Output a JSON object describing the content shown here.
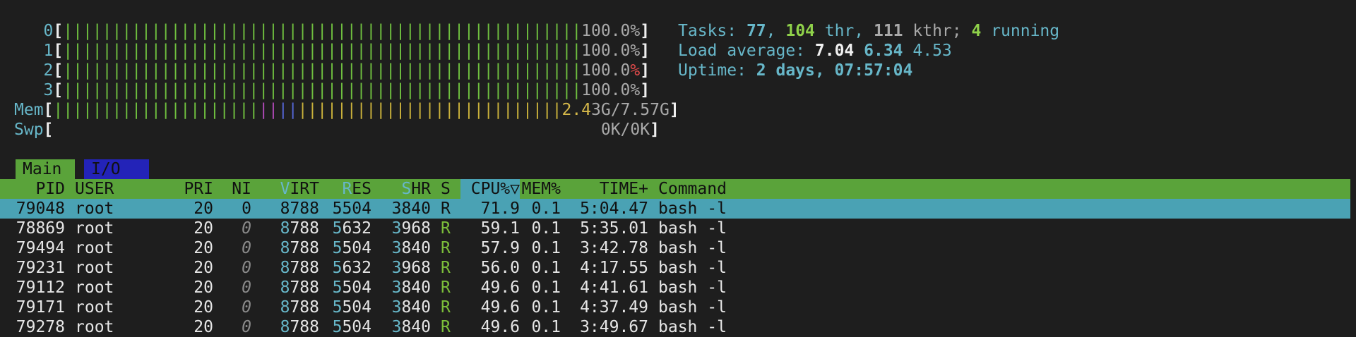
{
  "meters": {
    "cpus": [
      {
        "label": "0",
        "value": "100.0%"
      },
      {
        "label": "1",
        "value": "100.0%"
      },
      {
        "label": "2",
        "value": "100.0",
        "value_suffix": "%"
      },
      {
        "label": "3",
        "value": "100.0%"
      }
    ],
    "mem": {
      "label": "Mem",
      "value_used": "2.4",
      "value_rest": "3G/7.57G"
    },
    "swp": {
      "label": "Swp",
      "value": "0K/0K"
    }
  },
  "info": {
    "tasks_label": "Tasks: ",
    "tasks": "77",
    "thr_count": "104",
    "thr_label": " thr, ",
    "kthr_count": "111",
    "kthr_label": " kthr; ",
    "running_count": "4",
    "running_label": " running",
    "load_label": "Load average: ",
    "load1": "7.04",
    "load5": "6.34",
    "load15": "4.53",
    "uptime_label": "Uptime: ",
    "uptime": "2 days, 07:57:04"
  },
  "tabs": [
    {
      "label": "Main"
    },
    {
      "label": "I/O"
    }
  ],
  "columns": {
    "pid": "PID",
    "user": "USER",
    "pri": "PRI",
    "ni": "NI",
    "virt": "VIRT",
    "res": "RES",
    "shr": "SHR",
    "s": "S",
    "cpu": "CPU%▽",
    "mem": "MEM%",
    "time": "TIME+",
    "cmd": "Command"
  },
  "processes": [
    {
      "pid": "79048",
      "user": "root",
      "pri": "20",
      "ni": "0",
      "virt": "8788",
      "res": "5504",
      "shr": "3840",
      "s": "R",
      "cpu": "71.9",
      "mem": "0.1",
      "time": "5:04.47",
      "cmd": "bash -l"
    },
    {
      "pid": "78869",
      "user": "root",
      "pri": "20",
      "ni": "0",
      "virt": "8788",
      "res": "5632",
      "shr": "3968",
      "s": "R",
      "cpu": "59.1",
      "mem": "0.1",
      "time": "5:35.01",
      "cmd": "bash -l"
    },
    {
      "pid": "79494",
      "user": "root",
      "pri": "20",
      "ni": "0",
      "virt": "8788",
      "res": "5504",
      "shr": "3840",
      "s": "R",
      "cpu": "57.9",
      "mem": "0.1",
      "time": "3:42.78",
      "cmd": "bash -l"
    },
    {
      "pid": "79231",
      "user": "root",
      "pri": "20",
      "ni": "0",
      "virt": "8788",
      "res": "5632",
      "shr": "3968",
      "s": "R",
      "cpu": "56.0",
      "mem": "0.1",
      "time": "4:17.55",
      "cmd": "bash -l"
    },
    {
      "pid": "79112",
      "user": "root",
      "pri": "20",
      "ni": "0",
      "virt": "8788",
      "res": "5504",
      "shr": "3840",
      "s": "R",
      "cpu": "49.6",
      "mem": "0.1",
      "time": "4:41.61",
      "cmd": "bash -l"
    },
    {
      "pid": "79171",
      "user": "root",
      "pri": "20",
      "ni": "0",
      "virt": "8788",
      "res": "5504",
      "shr": "3840",
      "s": "R",
      "cpu": "49.6",
      "mem": "0.1",
      "time": "4:37.49",
      "cmd": "bash -l"
    },
    {
      "pid": "79278",
      "user": "root",
      "pri": "20",
      "ni": "0",
      "virt": "8788",
      "res": "5504",
      "shr": "3840",
      "s": "R",
      "cpu": "49.6",
      "mem": "0.1",
      "time": "3:49.67",
      "cmd": "bash -l"
    }
  ],
  "colors": {
    "header_bg": "#5aa33a",
    "selected_bg": "#4aa2b4",
    "io_tab_bg": "#2323b8",
    "text_cyan": "#67b7c9"
  }
}
